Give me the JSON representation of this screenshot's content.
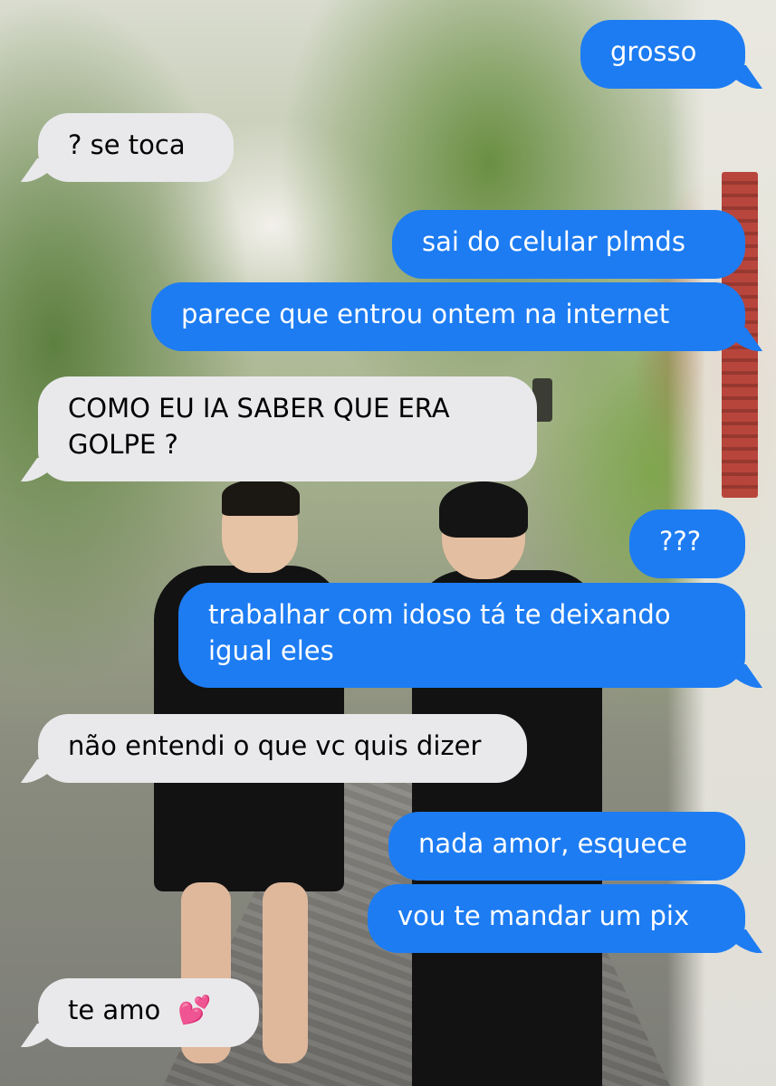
{
  "messages": [
    {
      "side": "sent",
      "text": "grosso"
    },
    {
      "side": "received",
      "text": "? se toca"
    },
    {
      "side": "sent",
      "text": "sai do celular plmds"
    },
    {
      "side": "sent",
      "text": "parece que entrou ontem na internet"
    },
    {
      "side": "received",
      "text": "COMO EU IA SABER QUE ERA GOLPE ?"
    },
    {
      "side": "sent",
      "text": "???"
    },
    {
      "side": "sent",
      "text": "trabalhar com idoso tá te deixando igual eles"
    },
    {
      "side": "received",
      "text": "não entendi o que vc quis dizer"
    },
    {
      "side": "sent",
      "text": "nada amor, esquece"
    },
    {
      "side": "sent",
      "text": "vou te mandar um pix"
    },
    {
      "side": "received",
      "text": "te amo",
      "emoji": "💕"
    }
  ],
  "colors": {
    "sent_bubble": "#1d7cf2",
    "received_bubble": "#e9e9eb",
    "emoji_hearts": "#e91e8c"
  },
  "icons": [
    "two-hearts-icon"
  ]
}
